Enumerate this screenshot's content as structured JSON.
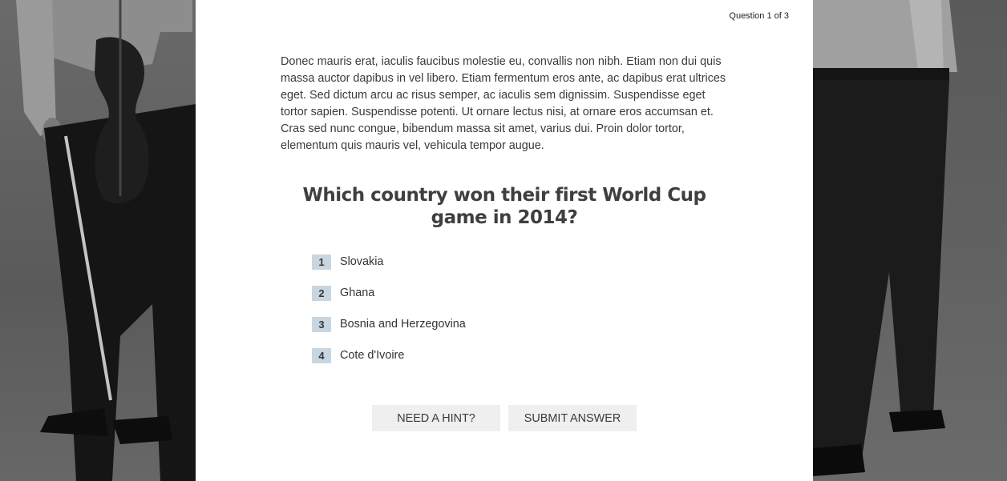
{
  "quiz": {
    "counter": "Question 1 of 3",
    "intro": "Donec mauris erat, iaculis faucibus molestie eu, convallis non nibh. Etiam non dui quis massa auctor dapibus in vel libero. Etiam fermentum eros ante, ac dapibus erat ultrices eget. Sed dictum arcu ac risus semper, ac iaculis sem dignissim. Suspendisse eget tortor sapien. Suspendisse potenti. Ut ornare lectus nisi, at ornare eros accumsan et. Cras sed nunc congue, bibendum massa sit amet, varius dui. Proin dolor tortor, elementum quis mauris vel, vehicula tempor augue.",
    "question": "Which country won their first World Cup game in 2014?",
    "options": [
      {
        "number": "1",
        "label": "Slovakia"
      },
      {
        "number": "2",
        "label": "Ghana"
      },
      {
        "number": "3",
        "label": "Bosnia and Herzegovina"
      },
      {
        "number": "4",
        "label": "Cote d'Ivoire"
      }
    ],
    "buttons": {
      "hint": "NEED A HINT?",
      "submit": "SUBMIT ANSWER"
    }
  },
  "colors": {
    "option_badge_bg": "#c9d6df",
    "button_bg": "#efefef",
    "panel_bg": "#ffffff"
  }
}
